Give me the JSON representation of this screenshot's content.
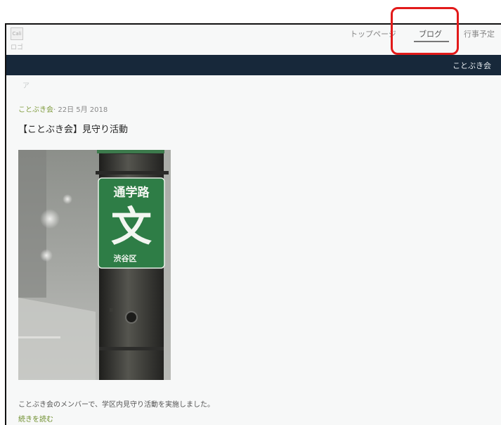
{
  "nav": {
    "logo_text": "Cali",
    "logo_sub": "ロゴ",
    "items": [
      {
        "label": "トップページ"
      },
      {
        "label": "ブログ",
        "active": true
      },
      {
        "label": "行事予定"
      }
    ]
  },
  "site_bar": {
    "title": "ことぶき会"
  },
  "breadcrumb": {
    "mark": "ア"
  },
  "post": {
    "author": "ことぶき会",
    "date": "· 22日 5月 2018",
    "title": "【ことぶき会】見守り活動",
    "image": {
      "sign_line1": "通学路",
      "sign_symbol": "文",
      "sign_ward": "渋谷区"
    },
    "excerpt": "ことぶき会のメンバーで、学区内見守り活動を実施しました。",
    "read_more": "続きを読む"
  },
  "colors": {
    "site_bar": "#17283a",
    "accent_green": "#7e9a3b",
    "highlight": "#e21a1a",
    "sign_green": "#2e7d46"
  }
}
